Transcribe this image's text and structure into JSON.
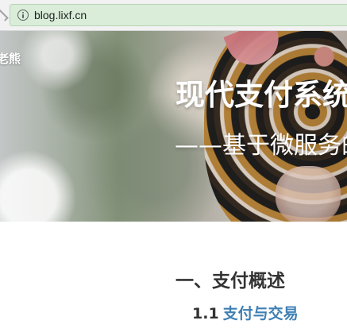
{
  "browser": {
    "url": "blog.lixf.cn",
    "security_icon": "info-icon",
    "omnibox_color": "#d9edd8"
  },
  "hero": {
    "brand": "老熊",
    "title": "现代支付系统",
    "subtitle": "——基于微服务的"
  },
  "article": {
    "section_title": "一、支付概述",
    "subsection_number": "1.1",
    "subsection_link": "支付与交易",
    "link_color": "#3f7fb3"
  }
}
